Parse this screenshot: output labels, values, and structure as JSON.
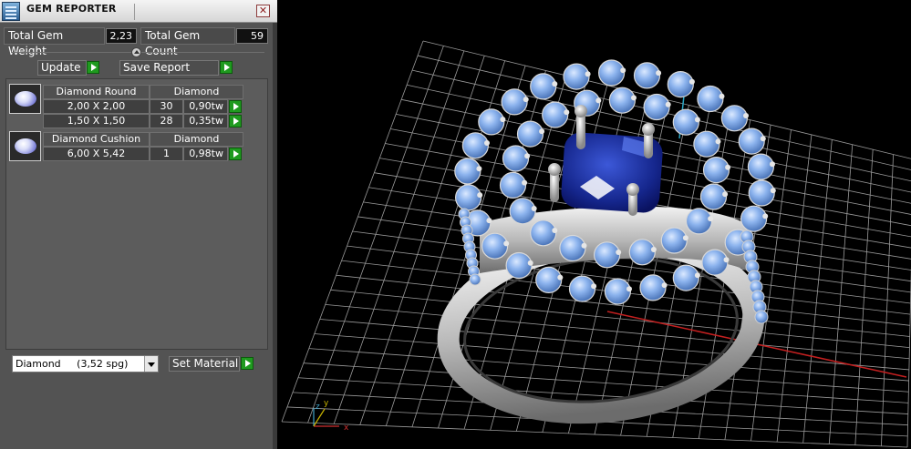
{
  "window": {
    "title": "GEM REPORTER",
    "close_glyph": "✕"
  },
  "stats": {
    "weight_label": "Total Gem Weight",
    "weight_value": "2,23",
    "count_label": "Total Gem Count",
    "count_value": "59"
  },
  "toolbar": {
    "update_label": "Update",
    "save_report_label": "Save Report"
  },
  "gem_groups": [
    {
      "icon": "round-gem-icon",
      "name": "Diamond Round",
      "material": "Diamond",
      "rows": [
        {
          "size": "2,00 X 2,00",
          "count": "30",
          "weight": "0,90tw"
        },
        {
          "size": "1,50 X 1,50",
          "count": "28",
          "weight": "0,35tw"
        }
      ]
    },
    {
      "icon": "cushion-gem-icon",
      "name": "Diamond Cushion",
      "material": "Diamond",
      "rows": [
        {
          "size": "6,00 X 5,42",
          "count": "1",
          "weight": "0,98tw"
        }
      ]
    }
  ],
  "material": {
    "selected": "Diamond     (3,52 spg)",
    "set_label": "Set Material"
  },
  "viewport": {
    "axis_x": "x",
    "axis_y": "y",
    "axis_z": "z"
  },
  "colors": {
    "accent_play": "#1f9a1f",
    "panel_bg": "#535353",
    "gem_center": "#1a2f9e",
    "gem_side": "#7aa7e6",
    "metal": "#c8c8c8"
  }
}
